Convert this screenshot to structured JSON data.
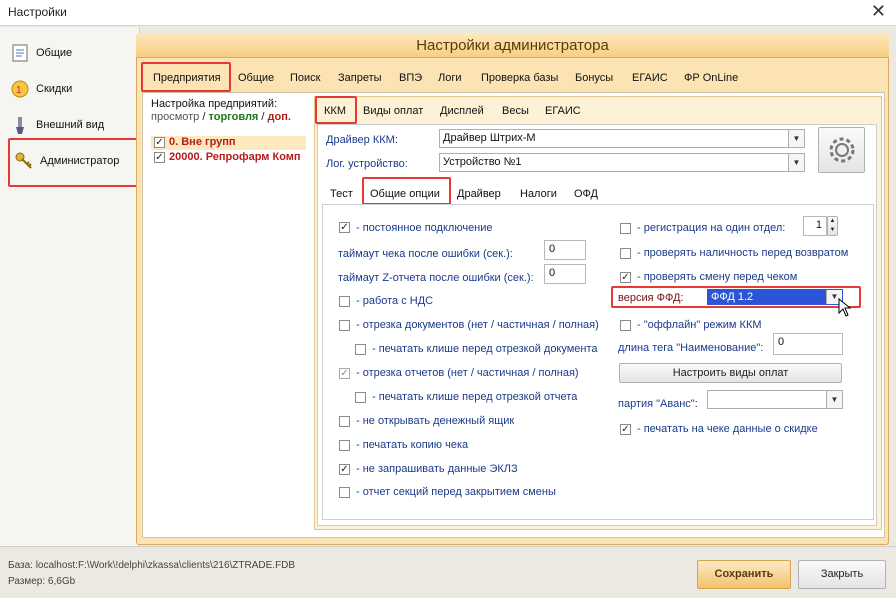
{
  "window": {
    "title": "Настройки"
  },
  "sidebar": {
    "items": [
      {
        "label": "Общие"
      },
      {
        "label": "Скидки"
      },
      {
        "label": "Внешний вид"
      },
      {
        "label": "Администратор"
      }
    ]
  },
  "main": {
    "title": "Настройки администратора"
  },
  "top_tabs": [
    "Предприятия",
    "Общие",
    "Поиск",
    "Запреты",
    "ВПЭ",
    "Логи",
    "Проверка базы",
    "Бонусы",
    "ЕГАИС",
    "ФР OnLine"
  ],
  "enterprise": {
    "header": "Настройка предприятий:",
    "mode_view": "просмотр",
    "mode_sep": "/",
    "mode_trade": "торговля",
    "mode_extra": "доп.",
    "items": [
      {
        "label": "0. Вне групп"
      },
      {
        "label": "20000. Репрофарм Комп"
      }
    ]
  },
  "sub_tabs": [
    "ККМ",
    "Виды оплат",
    "Дисплей",
    "Весы",
    "ЕГАИС"
  ],
  "kkm": {
    "driver_label": "Драйвер ККМ:",
    "driver_value": "Драйвер Штрих-М",
    "device_label": "Лог. устройство:",
    "device_value": "Устройство №1"
  },
  "kkm_tabs": [
    "Тест",
    "Общие опции",
    "Драйвер",
    "Налоги",
    "ОФД"
  ],
  "options_left": [
    {
      "label": "- постоянное подключение",
      "checked": true
    },
    {
      "label": "таймаут чека после ошибки (сек.):",
      "value": "0"
    },
    {
      "label": "таймаут Z-отчета после ошибки (сек.):",
      "value": "0"
    },
    {
      "label": "- работа с НДС",
      "checked": false
    },
    {
      "label": "- отрезка документов (нет / частичная / полная)",
      "checked": false
    },
    {
      "label": "- печатать клише перед отрезкой документа",
      "checked": false
    },
    {
      "label": "- отрезка отчетов (нет / частичная / полная)",
      "checked": true
    },
    {
      "label": "- печатать клише перед отрезкой отчета",
      "checked": false
    },
    {
      "label": "- не открывать денежный ящик",
      "checked": false
    },
    {
      "label": "- печатать копию чека",
      "checked": false
    },
    {
      "label": "- не запрашивать данные ЭКЛЗ",
      "checked": true
    },
    {
      "label": "- отчет секций перед закрытием смены",
      "checked": false
    }
  ],
  "options_right": {
    "reg_one_dept": {
      "label": "- регистрация на один отдел:",
      "value": "1"
    },
    "check_cash": {
      "label": "- проверять наличность перед возвратом"
    },
    "check_shift": {
      "label": "- проверять смену перед чеком"
    },
    "ffd_label": "версия ФФД:",
    "ffd_value": "ФФД 1.2",
    "offline": {
      "label": "- \"оффлайн\" режим ККМ"
    },
    "tag_len_label": "длина тега \"Наименование\":",
    "tag_len_value": "0",
    "config_payments_btn": "Настроить виды оплат",
    "advance_label": "партия \"Аванс\":",
    "print_discount": {
      "label": "- печатать на чеке данные о скидке"
    }
  },
  "footer": {
    "db": "База: localhost:F:\\Work\\!delphi\\zkassa\\clients\\216\\ZTRADE.FDB",
    "size": "Размер: 6,6Gb",
    "save": "Сохранить",
    "close": "Закрыть"
  }
}
